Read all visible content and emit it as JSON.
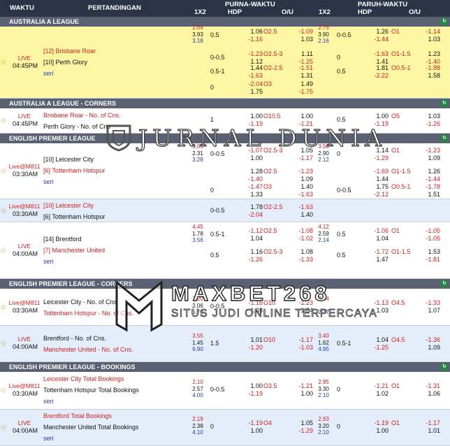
{
  "header": {
    "col_time": "WAKTU",
    "col_match": "PERTANDINGAN",
    "group_full": "PURNA-WAKTU",
    "group_half": "PARUH-WAKTU",
    "col_1x2": "1X2",
    "col_hdp": "HDP",
    "col_ou": "O/U",
    "col_1x2_h": "1X2",
    "col_hdp_h": "HDP",
    "col_ou_h": "O/U"
  },
  "refresh_icon": "refresh-icon",
  "watermarks": {
    "jurnal": "JURNAL DUNIA",
    "maxbet": "MAXBET268",
    "maxbet_tag": "SITUS JUDI ONLINE TERPERCAYA"
  },
  "colors": {
    "header_bg": "#2b3446",
    "section_bg": "#5a6173",
    "highlight": "#fdf7a3",
    "alt_row": "#e3eefa",
    "red": "#d51d1d",
    "blue": "#1a3fb5"
  },
  "sections": [
    {
      "title": "AUSTRALIA A LEAGUE",
      "matches": [
        {
          "status": "LIVE",
          "time": "04:45PM",
          "home": "[12] Brisbane Roar",
          "away": "[10] Perth Glory",
          "draw": "seri",
          "fav": "home",
          "x12": [
            "2.04",
            "3.93",
            "3.18"
          ],
          "x12h": [
            "2.75",
            "3.90",
            "2.16"
          ],
          "lines": [
            {
              "h": "0.5",
              "hu": "1.06",
              "hd": "-1.16",
              "o": "O2.5",
              "ou": "-1.09",
              "od": "1.03",
              "hh": "0-0.5",
              "hhu": "1.26",
              "hhd": "-1.44",
              "oh": "O1",
              "ohu": "-1.14",
              "ohd": "1.03"
            },
            {
              "h": "0-0.5",
              "hu": "-1.23",
              "hd": "1.12",
              "o": "O2.5-3",
              "ou": "1.11",
              "od": "-1.25",
              "hh": "0",
              "hhu": "-1.63",
              "hhd": "1.41",
              "oh": "O1-1.5",
              "ohu": "1.23",
              "ohd": "-1.40"
            },
            {
              "h": "0.5-1",
              "hu": "1.44",
              "hd": "-1.63",
              "o": "O2-2.5",
              "ou": "-1.51",
              "od": "1.31",
              "hh": "0.5",
              "hhu": "1.81",
              "hhd": "-2.22",
              "oh": "O0.5-1",
              "ohu": "-1.88",
              "ohd": "1.58"
            },
            {
              "h": "0",
              "hu": "-2.04",
              "hd": "1.75",
              "o": "O3",
              "ou": "1.49",
              "od": "-1.75",
              "hh": "",
              "hhu": "",
              "hhd": "",
              "oh": "",
              "ohu": "",
              "ohd": ""
            }
          ]
        }
      ]
    },
    {
      "title": "AUSTRALIA A LEAGUE - CORNERS",
      "matches": [
        {
          "status": "LIVE",
          "time": "04:45PM",
          "home": "Brisbane Roar - No. of Cns.",
          "away": "Perth Glory - No. of Cns",
          "draw": "",
          "fav": "home",
          "x12": [
            "",
            "",
            ""
          ],
          "x12h": [
            "",
            "",
            ""
          ],
          "lines": [
            {
              "h": "1",
              "hu": "1.00",
              "hd": "-1.19",
              "o": "O10.5",
              "ou": "1.00",
              "od": "-1.21",
              "hh": "0.5",
              "hhu": "1.00",
              "hhd": "-1.19",
              "oh": "O5",
              "ohu": "1.03",
              "ohd": "-1.26"
            }
          ]
        }
      ]
    },
    {
      "title": "ENGLISH PREMIER LEAGUE",
      "matches": [
        {
          "status": "Live@M811",
          "time": "03:30AM",
          "home": "[10] Leicester City",
          "away": "[6] Tottenham Hotspur",
          "draw": "seri",
          "fav": "away",
          "x12": [
            "3.05",
            "2.31",
            "3.28"
          ],
          "x12h": [
            "3.56",
            "2.90",
            "2.12"
          ],
          "lines": [
            {
              "h": "0-0.5",
              "hu": "-1.07",
              "hd": "1.00",
              "o": "O2.5-3",
              "ou": "1.05",
              "od": "-1.17",
              "hh": "0",
              "hhu": "1.14",
              "hhd": "-1.29",
              "oh": "O1",
              "ohu": "-1.23",
              "ohd": "1.09"
            },
            {
              "h": "",
              "hu": "1.28",
              "hd": "-1.40",
              "o": "O2.5",
              "ou": "-1.23",
              "od": "1.09",
              "hh": "",
              "hhu": "-1.69",
              "hhd": "1.44",
              "oh": "O1-1.5",
              "ohu": "1.26",
              "ohd": "-1.44"
            },
            {
              "h": "0",
              "hu": "-1.47",
              "hd": "1.33",
              "o": "O3",
              "ou": "1.40",
              "od": "-1.63",
              "hh": "0-0.5",
              "hhu": "1.75",
              "hhd": "-2.12",
              "oh": "O0.5-1",
              "ohu": "-1.78",
              "ohd": "1.51"
            }
          ]
        },
        {
          "status": "Live@M811",
          "time": "03:30AM",
          "home": "[10] Leicester City",
          "away": "[6] Tottenham Hotspur",
          "draw": "",
          "fav": "home",
          "x12": [
            "",
            "",
            ""
          ],
          "x12h": [
            "",
            "",
            ""
          ],
          "lines": [
            {
              "h": "0-0.5",
              "hu": "1.78",
              "hd": "-2.04",
              "o": "O2-2.5",
              "ou": "-1.63",
              "od": "1.40",
              "hh": "",
              "hhu": "",
              "hhd": "",
              "oh": "",
              "ohu": "",
              "ohd": ""
            }
          ]
        },
        {
          "status": "LIVE",
          "time": "04:00AM",
          "home": "[14] Brentford",
          "away": "[7] Manchester United",
          "draw": "seri",
          "fav": "away",
          "x12": [
            "4.45",
            "1.78",
            "3.56"
          ],
          "x12h": [
            "4.12",
            "2.59",
            "2.14"
          ],
          "lines": [
            {
              "h": "0.5-1",
              "hu": "-1.12",
              "hd": "1.04",
              "o": "O2.5",
              "ou": "-1.08",
              "od": "-1.02",
              "hh": "0.5",
              "hhu": "-1.06",
              "hhd": "1.04",
              "oh": "O1",
              "ohu": "-1.05",
              "ohd": "-1.05"
            },
            {
              "h": "0.5",
              "hu": "1.16",
              "hd": "-1.26",
              "o": "O2.5-3",
              "ou": "1.08",
              "od": "-1.33",
              "hh": "0.5",
              "hhu": "-1.72",
              "hhd": "1.47",
              "oh": "O1-1.5",
              "ohu": "1.53",
              "ohd": "-1.81"
            }
          ]
        }
      ]
    },
    {
      "title": "ENGLISH PREMIER LEAGUE - CORNERS",
      "matches": [
        {
          "status": "Live@M811",
          "time": "03:30AM",
          "home": "Leicester City - No. of Cns.",
          "away": "Tottenham Hotspur - No. of Cns.",
          "draw": "",
          "fav": "away",
          "x12": [
            "2.20",
            "2.06",
            "5.70"
          ],
          "x12h": [
            "2.54",
            "",
            "2.37"
          ],
          "lines": [
            {
              "h": "0-0.5",
              "hu": "-1.16",
              "hd": "1.03",
              "o": "O10",
              "ou": "-1.23",
              "od": "1.04",
              "hh": "",
              "hhu": "-1.13",
              "hhd": "1.03",
              "oh": "O4.5",
              "ohu": "-1.33",
              "ohd": "1.07"
            }
          ]
        },
        {
          "status": "LIVE",
          "time": "04:00AM",
          "home": "Brentford - No. of Cns.",
          "away": "Manchester United - No. of Cns.",
          "draw": "",
          "fav": "away",
          "x12": [
            "3.55",
            "1.45",
            "6.90"
          ],
          "x12h": [
            "3.40",
            "1.62",
            "4.95"
          ],
          "lines": [
            {
              "h": "1.5",
              "hu": "1.01",
              "hd": "-1.20",
              "o": "O10",
              "ou": "-1.17",
              "od": "-1.03",
              "hh": "0.5-1",
              "hhu": "1.04",
              "hhd": "-1.25",
              "oh": "O4.5",
              "ohu": "-1.36",
              "ohd": "1.09"
            }
          ]
        }
      ]
    },
    {
      "title": "ENGLISH PREMIER LEAGUE - BOOKINGS",
      "matches": [
        {
          "status": "Live@M811",
          "time": "03:30AM",
          "home": "Leicester City Total Bookings",
          "away": "Tottenham Hotspur Total Bookings",
          "draw": "seri",
          "fav": "home",
          "x12": [
            "2.10",
            "2.57",
            "4.00"
          ],
          "x12h": [
            "2.95",
            "3.30",
            "2.10"
          ],
          "lines": [
            {
              "h": "0-0.5",
              "hu": "1.00",
              "hd": "-1.19",
              "o": "O3.5",
              "ou": "-1.21",
              "od": "1.00",
              "hh": "0",
              "hhu": "-1.21",
              "hhd": "1.02",
              "oh": "O1",
              "ohu": "-1.31",
              "ohd": "1.06"
            }
          ]
        },
        {
          "status": "LIVE",
          "time": "04:00AM",
          "home": "Brentford Total Bookings",
          "away": "Manchester United Total Bookings",
          "draw": "seri",
          "fav": "home",
          "x12": [
            "2.19",
            "2.38",
            "4.10"
          ],
          "x12h": [
            "2.93",
            "3.20",
            "2.10"
          ],
          "lines": [
            {
              "h": "0",
              "hu": "-1.19",
              "hd": "1.00",
              "o": "O4",
              "ou": "1.05",
              "od": "-1.29",
              "hh": "0",
              "hhu": "-1.19",
              "hhd": "1.00",
              "oh": "O1",
              "ohu": "-1.17",
              "ohd": "1.01"
            }
          ]
        }
      ]
    }
  ]
}
